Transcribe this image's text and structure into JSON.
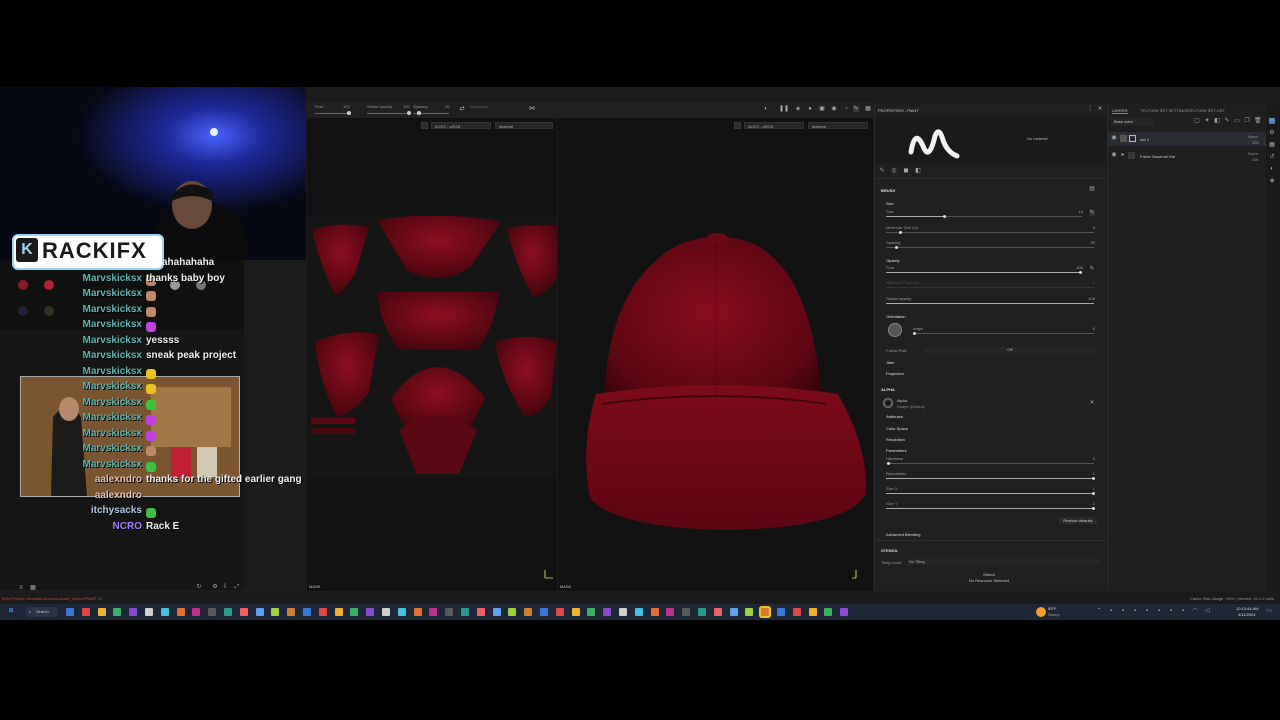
{
  "stream": {
    "logo_text": "RACKIFX",
    "chat": [
      {
        "user": "",
        "message": "ahahahaha",
        "emote": ""
      },
      {
        "user": "Marvskicksx",
        "message": "thanks baby boy",
        "emote": "face"
      },
      {
        "user": "Marvskicksx",
        "message": "",
        "emote": "face"
      },
      {
        "user": "Marvskicksx",
        "message": "",
        "emote": "face"
      },
      {
        "user": "Marvskicksx",
        "message": "",
        "emote": "purple"
      },
      {
        "user": "Marvskicksx",
        "message": "yessss",
        "emote": ""
      },
      {
        "user": "Marvskicksx",
        "message": "sneak peak project",
        "emote": ""
      },
      {
        "user": "Marvskicksx",
        "message": "",
        "emote": "yellow"
      },
      {
        "user": "Marvskicksx",
        "message": "",
        "emote": "yellow"
      },
      {
        "user": "Marvskicksx",
        "message": "",
        "emote": "green"
      },
      {
        "user": "Marvskicksx",
        "message": "",
        "emote": "purple"
      },
      {
        "user": "Marvskicksx",
        "message": "",
        "emote": "purple"
      },
      {
        "user": "Marvskicksx",
        "message": "",
        "emote": "face"
      },
      {
        "user": "Marvskicksx",
        "message": "",
        "emote": "green"
      },
      {
        "user": "aalexndro",
        "message": "thanks for the gifted earlier gang",
        "emote": ""
      },
      {
        "user": "aalexndro",
        "message": "",
        "emote": ""
      },
      {
        "user": "itchysacks",
        "message": "",
        "emote": "green"
      },
      {
        "user": "NCRO",
        "message": "Rack E",
        "emote": ""
      }
    ]
  },
  "toolbar": {
    "flow_label": "Flow",
    "flow_value": "100",
    "stroke_opacity_label": "Stroke opacity",
    "stroke_opacity_value": "100",
    "spacing_label": "Spacing",
    "spacing_value": "20",
    "symmetry_label": "Symmetry"
  },
  "viewports": {
    "uv": {
      "colorspace": "ACES - sRGB",
      "mode": "Material",
      "mask_label": "MASK"
    },
    "3d": {
      "colorspace": "ACES - sRGB",
      "mode": "Material",
      "mask_label": "MASK"
    }
  },
  "properties": {
    "title": "PROPERTIES - PAINT",
    "no_material": "No material",
    "brush_header": "BRUSH",
    "size_section": "Size",
    "size_label": "Size",
    "size_value": "10",
    "min_size_label": "Minimum Size (%)",
    "min_size_value": "5",
    "spacing_label": "Spacing",
    "spacing_value": "20",
    "opacity_section": "Opacity",
    "flow_label": "Flow",
    "flow_value": "100",
    "min_flow_label": "Minimum Flow (%)",
    "min_flow_value": "0",
    "stroke_opacity_label": "Stroke opacity",
    "stroke_opacity_value": "100",
    "orientation_section": "Orientation",
    "angle_label": "Angle",
    "angle_value": "0",
    "follow_path_label": "Follow Path",
    "follow_path_value": "Off",
    "jitter_section": "Jitter",
    "projection_section": "Projection",
    "alpha_header": "ALPHA",
    "alpha_name": "Alpha",
    "alpha_shape": "Shape (Default)",
    "attributes_section": "Attributes",
    "color_space_section": "Color Space",
    "resolution_section": "Resolution",
    "parameters_section": "Parameters",
    "hardness_label": "Hardness",
    "hardness_value": "0",
    "roundness_label": "Roundness",
    "roundness_value": "1",
    "size_x_label": "Size X",
    "size_x_value": "1",
    "size_y_label": "Size Y",
    "size_y_value": "1",
    "restore_defaults": "Restore defaults",
    "advanced_blending": "Advanced Blending",
    "stencil_header": "STENCIL",
    "tiling_mode_label": "Tiling mode",
    "tiling_mode_value": "No Tiling",
    "stencil_name": "Stencil",
    "stencil_none": "No Resource Selected"
  },
  "layers": {
    "tabs": [
      "LAYERS",
      "TEXTURE SET SETTINGS",
      "TEXTURE SET LIST"
    ],
    "channel": "Base color",
    "items": [
      {
        "name": "red 1",
        "blend": "Norm",
        "opacity": "100"
      },
      {
        "name": "Fabric Baseball Hat",
        "blend": "Norm",
        "opacity": "100"
      }
    ]
  },
  "status": {
    "left": "[Info] Project: threaded Account.space_zynhz3/PAWF-12",
    "right": "Cache Disk Usage : 84% | Version: 10.1.2 build"
  },
  "taskbar": {
    "search": "Search",
    "weather_temp": "59°F",
    "weather_desc": "Sunny",
    "time": "10:13:44 AM",
    "date": "4/11/2024"
  },
  "colors": {
    "hat_red": "#8a0d1e",
    "chat_name": "#5fb4b0",
    "panel_bg": "#202020"
  }
}
